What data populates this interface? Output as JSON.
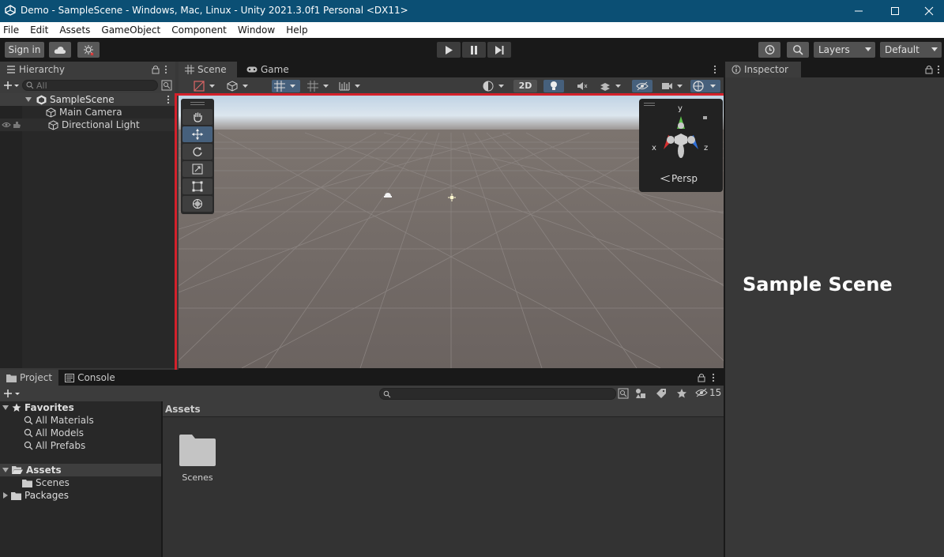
{
  "window": {
    "title": "Demo - SampleScene - Windows, Mac, Linux - Unity 2021.3.0f1 Personal <DX11>"
  },
  "menu": [
    "File",
    "Edit",
    "Assets",
    "GameObject",
    "Component",
    "Window",
    "Help"
  ],
  "toolbar": {
    "sign_in": "Sign in",
    "layers": "Layers",
    "layout": "Default"
  },
  "hierarchy": {
    "tab": "Hierarchy",
    "search_placeholder": "All",
    "scene": "SampleScene",
    "items": [
      "Main Camera",
      "Directional Light"
    ]
  },
  "scene_view": {
    "tabs": [
      "Scene",
      "Game"
    ],
    "mode_2d": "2D",
    "projection": "Persp",
    "gizmo_axes": {
      "x": "x",
      "y": "y",
      "z": "z"
    }
  },
  "inspector": {
    "tab": "Inspector"
  },
  "project": {
    "tabs": [
      "Project",
      "Console"
    ],
    "favorites_label": "Favorites",
    "favorites": [
      "All Materials",
      "All Models",
      "All Prefabs"
    ],
    "assets_label": "Assets",
    "asset_children": [
      "Scenes"
    ],
    "packages_label": "Packages",
    "breadcrumb": "Assets",
    "hidden_count": "15",
    "grid_items": [
      "Scenes"
    ]
  },
  "annotation": {
    "label": "Sample Scene"
  },
  "colors": {
    "titlebar": "#0b4f74",
    "highlight_box": "#d4212b",
    "active_blue": "#46607c"
  }
}
